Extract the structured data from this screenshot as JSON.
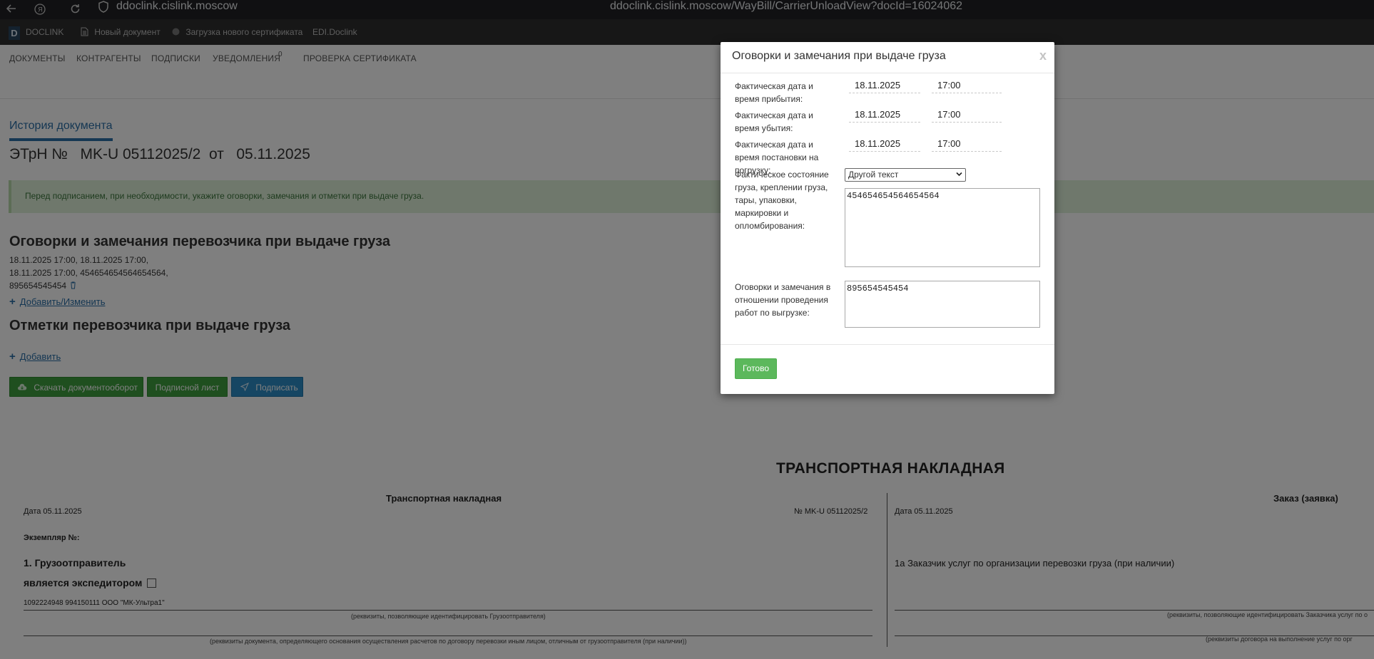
{
  "browser": {
    "host": "ddoclink.cislink.moscow",
    "url": "ddoclink.cislink.moscow/WayBill/CarrierUnloadView?docId=16024062",
    "back_icon": "arrow-left-icon",
    "site_icon": "shield-icon"
  },
  "appbar": {
    "logo_letter": "D",
    "brand": "DOCLINK",
    "new_doc": "Новый документ",
    "upload_cert": "Загрузка нового сертификата",
    "edi": "EDI.Doclink"
  },
  "menu": {
    "documents": "ДОКУМЕНТЫ",
    "counterparties": "КОНТРАГЕНТЫ",
    "signatures": "ПОДПИСКИ",
    "notifications": "УВЕДОМЛЕНИЯ",
    "notifications_count": "0",
    "check_cert": "ПРОВЕРКА СЕРТИФИКАТА"
  },
  "page": {
    "history_tab": "История документа",
    "doc_title": "ЭТрН №   MK-U 05112025/2  от   05.11.2025",
    "alert": "Перед подписанием, при необходимости, укажите оговорки, замечания и отметки при выдаче груза.",
    "reservations_heading": "Оговорки и замечания перевозчика при выдаче груза",
    "reservations_line1": "18.11.2025  17:00, 18.11.2025  17:00,",
    "reservations_line2": "18.11.2025  17:00, 454654654564654564,",
    "reservations_line3": "895654545454",
    "add_change": "Добавить/Изменить",
    "marks_heading": "Отметки перевозчика при выдаче груза",
    "add": "Добавить",
    "btn_download": "Скачать документооборот",
    "btn_sign_sheet": "Подписной лист",
    "btn_sign": "Подписать"
  },
  "paper": {
    "title": "ТРАНСПОРТНАЯ НАКЛАДНАЯ",
    "left_header": "Транспортная накладная",
    "right_header": "Заказ (заявка)",
    "date_left": "Дата  05.11.2025",
    "number_left": "№   MK-U 05112025/2",
    "date_right": "Дата 05.11.2025",
    "copy_label": "Экземпляр №:",
    "shipper": "1. Грузоотправитель",
    "is_forwarder": "является экспедитором",
    "shipper_value": "1092224948 994150111 ООО \"МК-Ультра1\"",
    "hint_shipper": "(реквизиты, позволяющие идентифицировать Грузоотправителя)",
    "hint_doc": "(реквизиты документа, определяющего основания осуществления расчетов по договору перевозки иным лицом, отличным от грузоотправителя (при наличии))",
    "customer": "1а Заказчик услуг по организации перевозки груза (при наличии)",
    "hint_customer": "(реквизиты, позволяющие идентифицировать Заказчика услуг по о",
    "hint_contract": "(реквизиты договора на выполнение услуг по орг"
  },
  "modal": {
    "title": "Оговорки и замечания при выдаче груза",
    "close": "x",
    "arrival_label": "Фактическая дата и время прибытия:",
    "arrival_date": "18.11.2025",
    "arrival_time": "17:00",
    "departure_label": "Фактическая дата и время убытия:",
    "departure_date": "18.11.2025",
    "departure_time": "17:00",
    "loading_label": "Фактическая дата и время постановки на погрузку:",
    "loading_date": "18.11.2025",
    "loading_time": "17:00",
    "state_label": "Фактическое состояние груза, креплении груза, тары, упаковки, маркировки и опломбирования:",
    "state_select": "Другой текст",
    "state_text": "454654654564654564",
    "unload_label": "Оговорки и замечания в отношении проведения работ по выгрузке:",
    "unload_text": "895654545454",
    "ok": "Готово"
  }
}
